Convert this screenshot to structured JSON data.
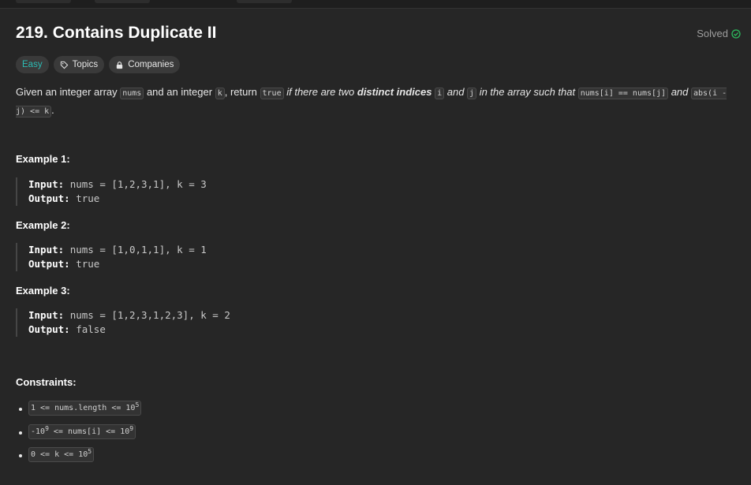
{
  "problem": {
    "title": "219. Contains Duplicate II",
    "status": "Solved",
    "difficulty": "Easy",
    "topics_label": "Topics",
    "companies_label": "Companies"
  },
  "description": {
    "p1": "Given an integer array ",
    "code_nums": "nums",
    "p2": " and an integer ",
    "code_k": "k",
    "p3": ", return ",
    "code_true": "true",
    "p4": " if there are two ",
    "bold_distinct": "distinct indices",
    "code_i": "i",
    "p5": " and ",
    "code_j": "j",
    "p6": " in the array such that ",
    "code_eq": "nums[i] == nums[j]",
    "p7": " and ",
    "code_abs": "abs(i - j) <= k",
    "p8": "."
  },
  "examples": [
    {
      "title": "Example 1:",
      "input_label": "Input:",
      "input": "nums = [1,2,3,1], k = 3",
      "output_label": "Output:",
      "output": "true"
    },
    {
      "title": "Example 2:",
      "input_label": "Input:",
      "input": "nums = [1,0,1,1], k = 1",
      "output_label": "Output:",
      "output": "true"
    },
    {
      "title": "Example 3:",
      "input_label": "Input:",
      "input": "nums = [1,2,3,1,2,3], k = 2",
      "output_label": "Output:",
      "output": "false"
    }
  ],
  "constraints": {
    "title": "Constraints:",
    "c1_a": "1 <= nums.length <= 10",
    "c1_sup": "5",
    "c2_a": "-10",
    "c2_sup1": "9",
    "c2_b": " <= nums[i] <= 10",
    "c2_sup2": "9",
    "c3_a": "0 <= k <= 10",
    "c3_sup": "5"
  },
  "colors": {
    "easy": "#2cbbb4",
    "solved_check": "#2cbb5d",
    "background": "#262626"
  },
  "icons": [
    "tag-icon",
    "lock-icon",
    "check-circle-icon"
  ]
}
